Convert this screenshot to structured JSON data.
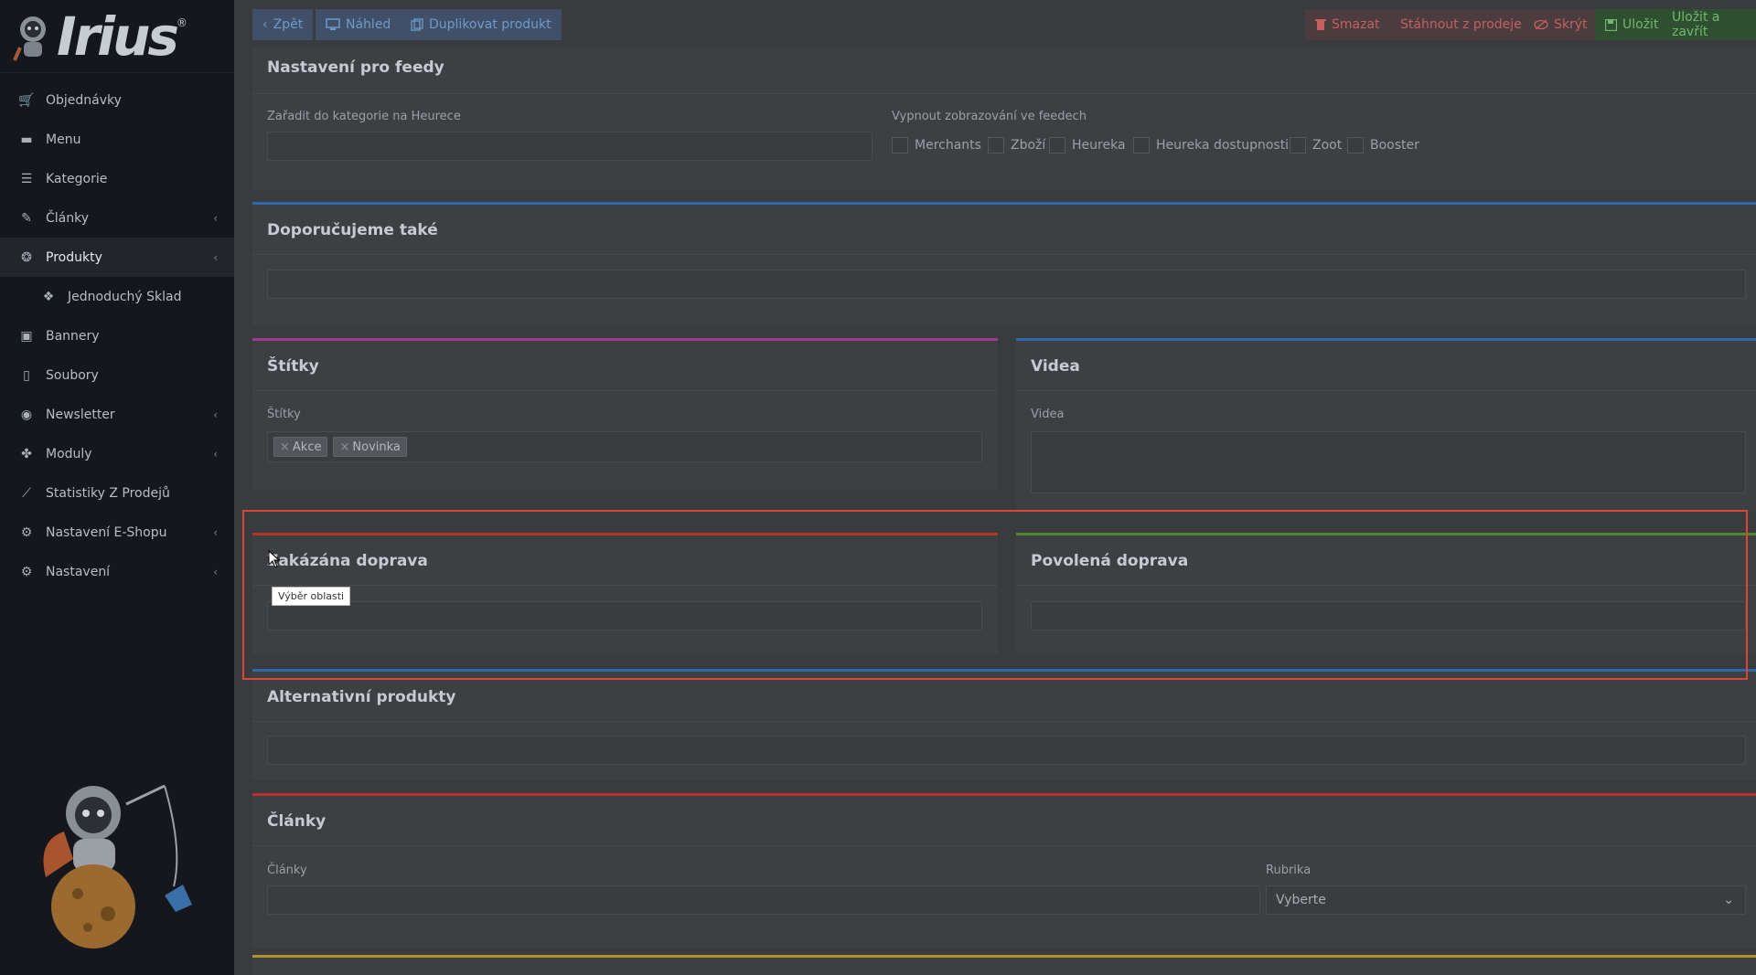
{
  "sidebar": {
    "logo_text": "Irius",
    "logo_mark": "®",
    "items": [
      {
        "label": "Objednávky",
        "icon": "cart-icon",
        "chevron": false,
        "active": false
      },
      {
        "label": "Menu",
        "icon": "folder-icon",
        "chevron": false,
        "active": false
      },
      {
        "label": "Kategorie",
        "icon": "list-icon",
        "chevron": false,
        "active": false
      },
      {
        "label": "Články",
        "icon": "pencil-icon",
        "chevron": true,
        "active": false
      },
      {
        "label": "Produkty",
        "icon": "aperture-icon",
        "chevron": true,
        "active": true
      },
      {
        "label": "Jednoduchý Sklad",
        "icon": "boxes-icon",
        "chevron": false,
        "active": false,
        "sub": true
      },
      {
        "label": "Bannery",
        "icon": "image-icon",
        "chevron": false,
        "active": false
      },
      {
        "label": "Soubory",
        "icon": "file-icon",
        "chevron": false,
        "active": false
      },
      {
        "label": "Newsletter",
        "icon": "envelope-circle-icon",
        "chevron": true,
        "active": false
      },
      {
        "label": "Moduly",
        "icon": "puzzle-icon",
        "chevron": true,
        "active": false
      },
      {
        "label": "Statistiky Z Prodejů",
        "icon": "chart-line-icon",
        "chevron": false,
        "active": false
      },
      {
        "label": "Nastavení E-Shopu",
        "icon": "cogs-icon",
        "chevron": true,
        "active": false
      },
      {
        "label": "Nastavení",
        "icon": "cogs-icon",
        "chevron": true,
        "active": false
      }
    ],
    "chevron_glyph": "‹"
  },
  "toolbar": {
    "back": "Zpět",
    "preview": "Náhled",
    "duplicate": "Duplikovat produkt",
    "delete": "Smazat",
    "withdraw": "Stáhnout z prodeje",
    "hide": "Skrýt",
    "save": "Uložit",
    "save_close": "Uložit a zavřít"
  },
  "feeds": {
    "title": "Nastavení pro feedy",
    "heureka_category_label": "Zařadit do kategorie na Heurece",
    "disable_label": "Vypnout zobrazování ve feedech",
    "options": [
      "Merchants",
      "Zboží",
      "Heureka",
      "Heureka dostupnosti",
      "Zoot",
      "Booster"
    ]
  },
  "recommended": {
    "title": "Doporučujeme také"
  },
  "tags": {
    "title": "Štítky",
    "label": "Štítky",
    "values": [
      "Akce",
      "Novinka"
    ],
    "remove_glyph": "×"
  },
  "videos": {
    "title": "Videa",
    "label": "Videa"
  },
  "forbidden_shipping": {
    "title": "Zakázána doprava",
    "tooltip": "Výběr oblasti"
  },
  "allowed_shipping": {
    "title": "Povolená doprava"
  },
  "alternatives": {
    "title": "Alternativní produkty"
  },
  "articles": {
    "title": "Články",
    "label": "Články",
    "rubric_label": "Rubrika",
    "rubric_value": "Vyberte"
  },
  "colors": {
    "accent_blue": "#2f6aa8",
    "accent_pink": "#a03a8a",
    "accent_red": "#b8332b",
    "accent_green": "#4d8a2f",
    "accent_yellow": "#b0902a",
    "highlight": "#d9473a"
  }
}
